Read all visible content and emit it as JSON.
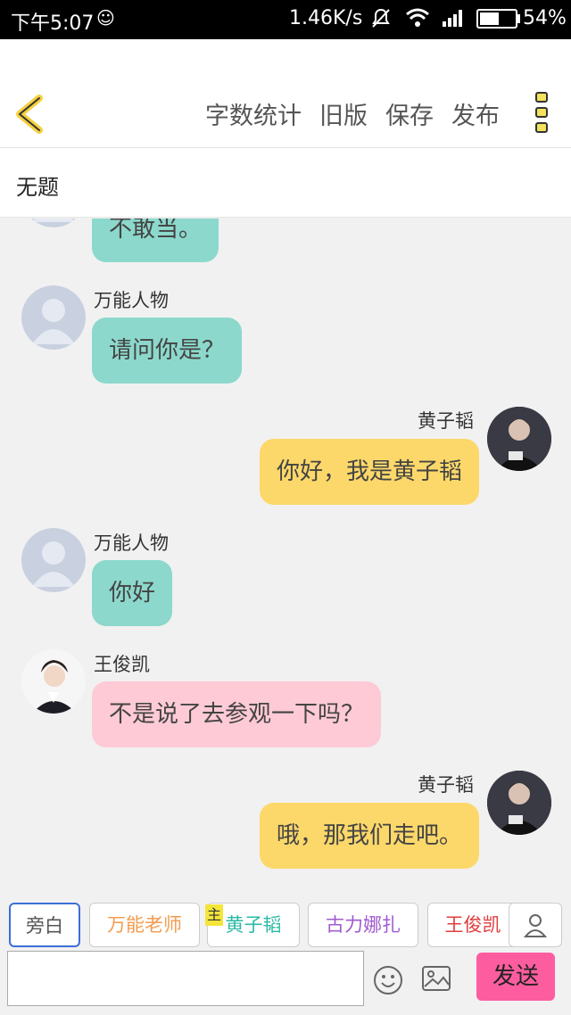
{
  "status": {
    "time": "下午5:07",
    "net_speed": "1.46K/s",
    "battery_pct": "54%",
    "battery_level": 0.54
  },
  "header": {
    "actions": [
      "字数统计",
      "旧版",
      "保存",
      "发布"
    ]
  },
  "doc": {
    "title": "无题"
  },
  "messages": [
    {
      "side": "left",
      "name": "",
      "text": "不敢当。",
      "avatar": "default-avatar"
    },
    {
      "side": "left",
      "name": "万能人物",
      "text": "请问你是？",
      "avatar": "default-avatar"
    },
    {
      "side": "right",
      "name": "黄子韬",
      "text": "你好，我是黄子韬",
      "avatar": "photo-avatar"
    },
    {
      "side": "left",
      "name": "万能人物",
      "text": "你好",
      "avatar": "default-avatar"
    },
    {
      "side": "left",
      "name": "王俊凯",
      "text": "不是说了去参观一下吗？",
      "avatar": "photo-avatar"
    },
    {
      "side": "right",
      "name": "黄子韬",
      "text": "哦，那我们走吧。",
      "avatar": "photo-avatar"
    }
  ],
  "characters": [
    {
      "label": "旁白",
      "color": "#555555"
    },
    {
      "label": "万能老师",
      "color": "#f39b4f"
    },
    {
      "label": "黄子韬",
      "color": "#2cb8a6"
    },
    {
      "label": "古力娜扎",
      "color": "#a05ad0"
    },
    {
      "label": "王俊凯",
      "color": "#e03c3c"
    }
  ],
  "main_tag": "主",
  "composer": {
    "value": "",
    "send_label": "发送"
  },
  "colors": {
    "teal_bubble": "#8cd8cc",
    "yellow_bubble": "#fcd86a",
    "pink_bubble": "#fecad6",
    "send_button": "#fd5d9f"
  }
}
